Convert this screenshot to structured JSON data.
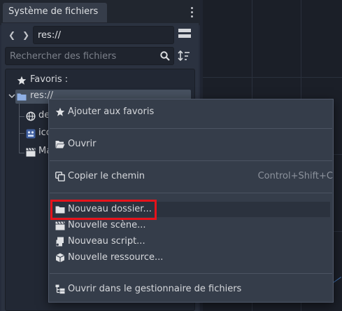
{
  "dock": {
    "tab_title": "Système de fichiers",
    "path": "res://",
    "search_placeholder": "Rechercher des fichiers"
  },
  "tree": {
    "favorites_label": "Favoris :",
    "root_label": "res://",
    "items": [
      {
        "label": "de",
        "icon": "globe-icon"
      },
      {
        "label": "ico",
        "icon": "image-icon"
      },
      {
        "label": "Ma",
        "icon": "clapperboard-icon"
      }
    ]
  },
  "context_menu": {
    "items": [
      {
        "label": "Ajouter aux favoris",
        "icon": "star-icon"
      },
      {
        "label": "Ouvrir",
        "icon": "folder-open-icon"
      },
      {
        "label": "Copier le chemin",
        "icon": "copy-icon",
        "shortcut": "Control+Shift+C"
      },
      {
        "label": "Nouveau dossier...",
        "icon": "folder-icon"
      },
      {
        "label": "Nouvelle scène...",
        "icon": "clapperboard-icon"
      },
      {
        "label": "Nouveau script...",
        "icon": "script-icon"
      },
      {
        "label": "Nouvelle ressource...",
        "icon": "resource-cube-icon"
      },
      {
        "label": "Ouvrir dans le gestionnaire de fichiers",
        "icon": "filesystem-icon"
      }
    ]
  },
  "colors": {
    "highlight_box": "#e6131b",
    "folder_icon": "#8fb0e5",
    "selected_row": "#46505f"
  }
}
